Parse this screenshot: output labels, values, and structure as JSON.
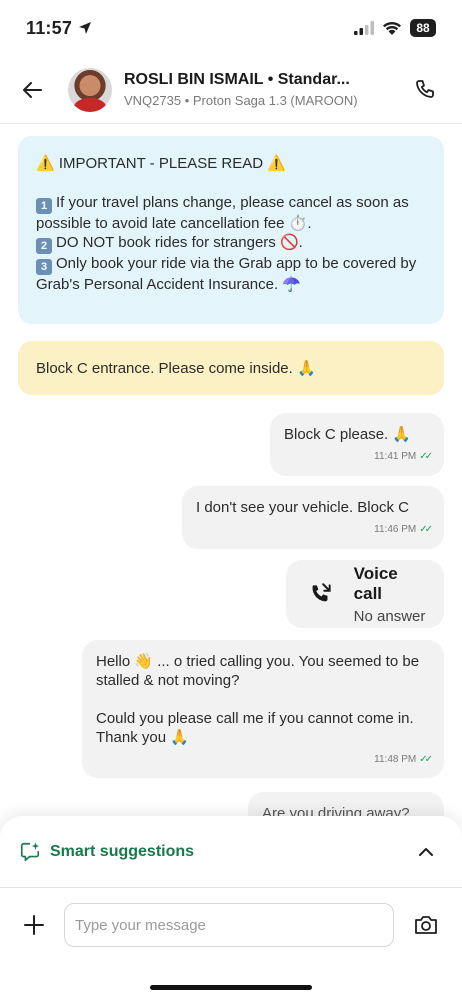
{
  "status_bar": {
    "time": "11:57",
    "battery": "88"
  },
  "header": {
    "driver_name": "ROSLI BIN ISMAIL • Standar...",
    "vehicle": "VNQ2735 • Proton Saga 1.3 (MAROON)"
  },
  "notice": {
    "title": "⚠️ IMPORTANT - PLEASE READ ⚠️",
    "items": [
      {
        "key": "1",
        "text": "If your travel plans change, please cancel as soon as possible to avoid late cancellation fee ⏱️."
      },
      {
        "key": "2",
        "text": "DO NOT book rides for strangers 🚫."
      },
      {
        "key": "3",
        "text": "Only book your ride via the Grab app to be covered by Grab's Personal Accident Insurance. ☂️"
      }
    ]
  },
  "pinned_message": "Block C entrance. Please come inside. 🙏",
  "messages": [
    {
      "text": "Block C please. 🙏",
      "time": "11:41 PM"
    },
    {
      "text": "I don't see your vehicle. Block C",
      "time": "11:46 PM"
    },
    {
      "paragraphs": [
        "Hello 👋 ... o tried calling you. You seemed to be stalled & not moving?",
        "Could you please call me if you cannot come in. Thank you 🙏"
      ],
      "time": "11:48 PM"
    },
    {
      "text": "Are you driving away?"
    }
  ],
  "voice_call": {
    "title": "Voice call",
    "status": "No answer"
  },
  "smart_suggestions": {
    "label": "Smart suggestions"
  },
  "composer": {
    "placeholder": "Type your message"
  },
  "colors": {
    "accent_green": "#167a4b",
    "notice_bg": "#e3f4fa",
    "pinned_bg": "#fbf1c4",
    "bubble_bg": "#f2f2f2"
  }
}
